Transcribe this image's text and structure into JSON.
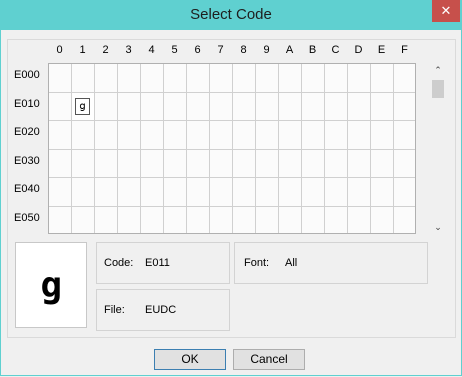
{
  "window": {
    "title": "Select Code",
    "close_glyph": "✕"
  },
  "grid": {
    "columns": [
      "0",
      "1",
      "2",
      "3",
      "4",
      "5",
      "6",
      "7",
      "8",
      "9",
      "A",
      "B",
      "C",
      "D",
      "E",
      "F"
    ],
    "rows": [
      "E000",
      "E010",
      "E020",
      "E030",
      "E040",
      "E050"
    ],
    "selected": {
      "row": 1,
      "col": 1,
      "glyph": "ց"
    }
  },
  "scrollbar": {
    "up_glyph": "⌃",
    "down_glyph": "⌄"
  },
  "preview": {
    "glyph": "ց"
  },
  "info": {
    "code_label": "Code:",
    "code_value": "E011",
    "font_label": "Font:",
    "font_value": "All",
    "file_label": "File:",
    "file_value": "EUDC"
  },
  "buttons": {
    "ok": "OK",
    "cancel": "Cancel"
  }
}
